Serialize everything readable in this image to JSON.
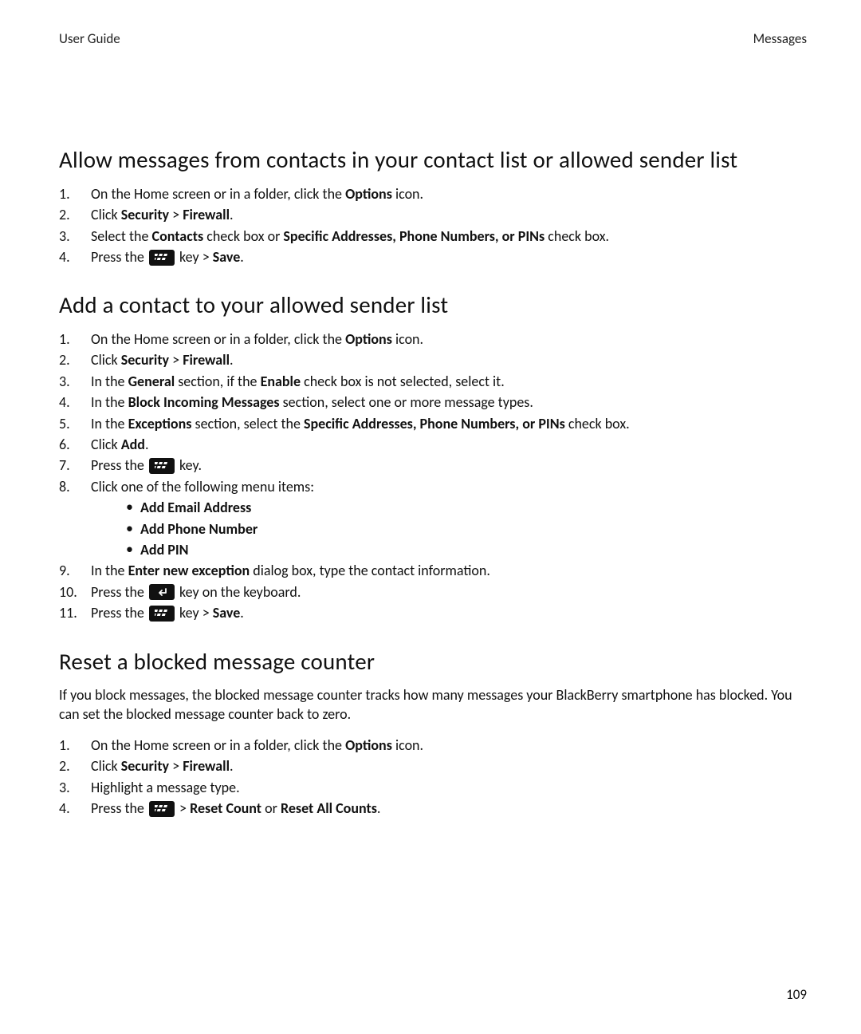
{
  "header": {
    "left": "User Guide",
    "right": "Messages"
  },
  "sections": {
    "s1": {
      "title": "Allow messages from contacts in your contact list or allowed sender list",
      "steps": {
        "i1a": "On the Home screen or in a folder, click the ",
        "i1b": "Options",
        "i1c": " icon.",
        "i2a": "Click ",
        "i2b": "Security",
        "i2c": " > ",
        "i2d": "Firewall",
        "i2e": ".",
        "i3a": "Select the ",
        "i3b": "Contacts",
        "i3c": " check box or ",
        "i3d": "Specific Addresses, Phone Numbers, or PINs",
        "i3e": " check box.",
        "i4a": "Press the ",
        "i4b": " key > ",
        "i4c": "Save",
        "i4d": "."
      }
    },
    "s2": {
      "title": "Add a contact to your allowed sender list",
      "steps": {
        "i1a": "On the Home screen or in a folder, click the ",
        "i1b": "Options",
        "i1c": " icon.",
        "i2a": "Click ",
        "i2b": "Security",
        "i2c": " > ",
        "i2d": "Firewall",
        "i2e": ".",
        "i3a": "In the ",
        "i3b": "General",
        "i3c": " section, if the ",
        "i3d": "Enable",
        "i3e": " check box is not selected, select it.",
        "i4a": "In the ",
        "i4b": "Block Incoming Messages",
        "i4c": " section, select one or more message types.",
        "i5a": "In the ",
        "i5b": "Exceptions",
        "i5c": " section, select the ",
        "i5d": "Specific Addresses, Phone Numbers, or PINs",
        "i5e": " check box.",
        "i6a": "Click ",
        "i6b": "Add",
        "i6c": ".",
        "i7a": "Press the ",
        "i7b": " key.",
        "i8a": "Click one of the following menu items:",
        "sub1": "Add Email Address",
        "sub2": "Add Phone Number",
        "sub3": "Add PIN",
        "i9a": "In the ",
        "i9b": "Enter new exception",
        "i9c": " dialog box, type the contact information.",
        "i10a": "Press the ",
        "i10b": " key on the keyboard.",
        "i11a": "Press the ",
        "i11b": " key > ",
        "i11c": "Save",
        "i11d": "."
      }
    },
    "s3": {
      "title": "Reset a blocked message counter",
      "intro": "If you block messages, the blocked message counter tracks how many messages your BlackBerry smartphone has blocked. You can set the blocked message counter back to zero.",
      "steps": {
        "i1a": "On the Home screen or in a folder, click the ",
        "i1b": "Options",
        "i1c": " icon.",
        "i2a": "Click ",
        "i2b": "Security",
        "i2c": " > ",
        "i2d": "Firewall",
        "i2e": ".",
        "i3a": "Highlight a message type.",
        "i4a": "Press the ",
        "i4b": " > ",
        "i4c": "Reset Count",
        "i4d": " or ",
        "i4e": "Reset All Counts",
        "i4f": "."
      }
    }
  },
  "page_number": "109"
}
